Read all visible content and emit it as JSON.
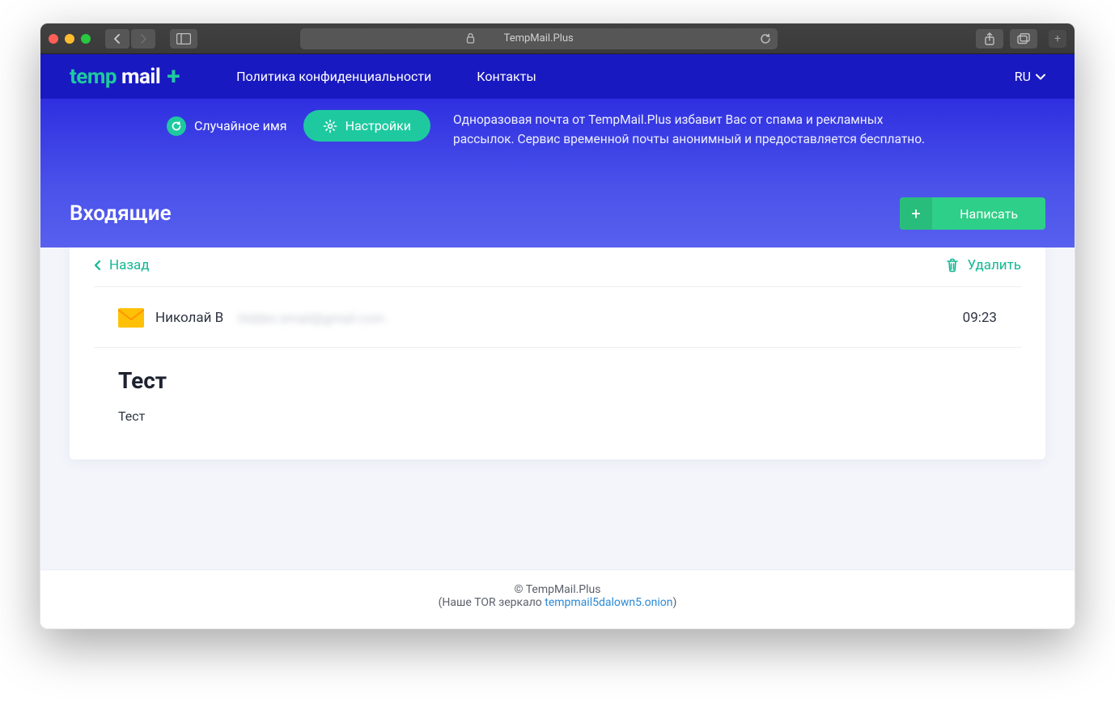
{
  "browser": {
    "address": "TempMail.Plus"
  },
  "header": {
    "logo_temp": "temp",
    "logo_mail": "mail",
    "logo_plus": "+",
    "nav": {
      "privacy": "Политика конфиденциальности",
      "contacts": "Контакты"
    },
    "lang": "RU"
  },
  "hero": {
    "random_name": "Случайное имя",
    "settings": "Настройки",
    "description": "Одноразовая почта от TempMail.Plus избавит Вас от спама и рекламных рассылок. Сервис временной почты анонимный и предоставляется бесплатно."
  },
  "inbox": {
    "title": "Входящие",
    "compose": "Написать"
  },
  "card": {
    "back": "Назад",
    "delete": "Удалить"
  },
  "message": {
    "sender": "Николай В",
    "sender_email": "hidden.email@gmail.com",
    "time": "09:23",
    "subject": "Тест",
    "body": "Тест"
  },
  "footer": {
    "copyright": "© TempMail.Plus",
    "mirror_prefix": "(Наше TOR зеркало ",
    "mirror_link": "tempmail5dalown5.onion",
    "mirror_suffix": ")"
  }
}
